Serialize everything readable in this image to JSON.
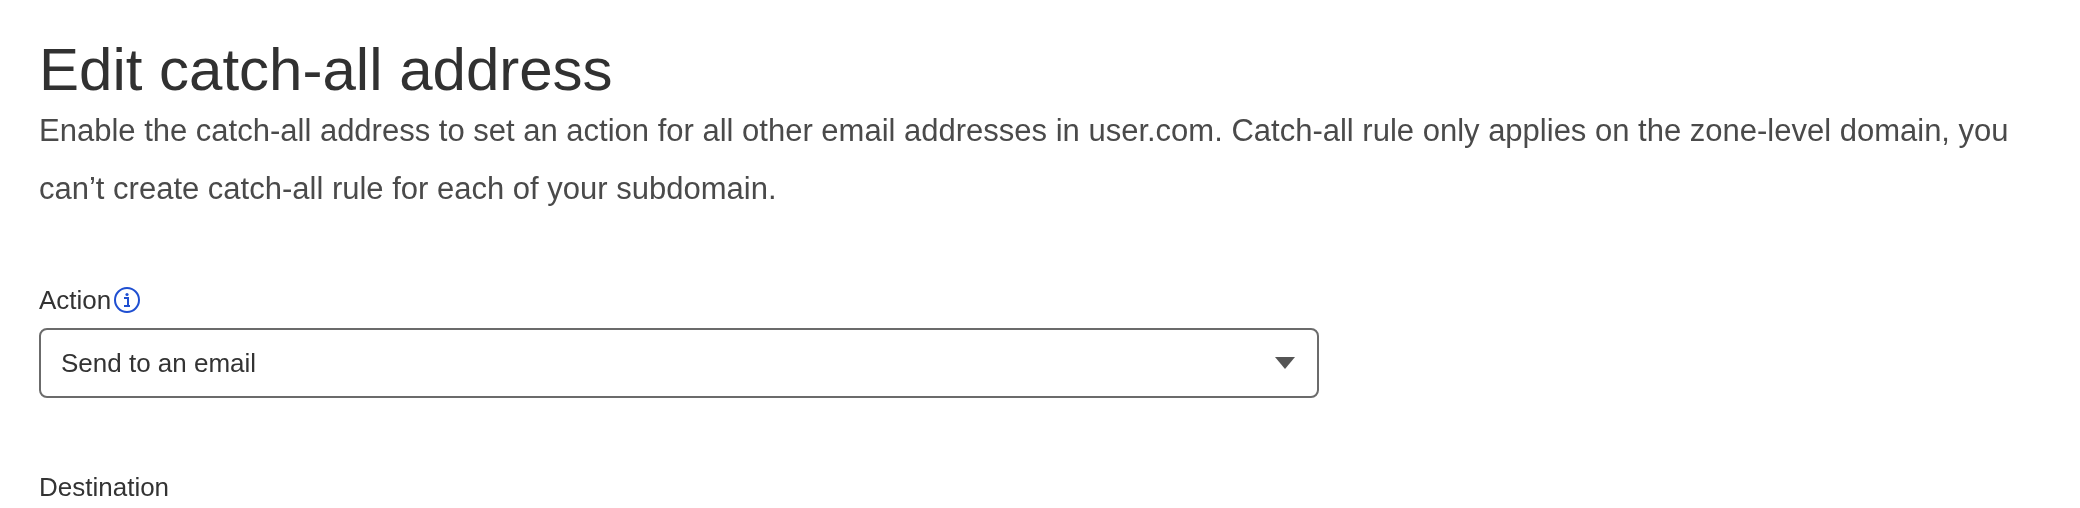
{
  "title": "Edit catch-all address",
  "description": "Enable the catch-all address to set an action for all other email addresses in user.com. Catch-all rule only applies on the zone-level domain, you can’t create catch-all rule for each of your subdomain.",
  "fields": [
    {
      "kind": "select",
      "label": "Action",
      "info": true,
      "value": "Send to an email"
    },
    {
      "kind": "label",
      "label": "Destination"
    }
  ]
}
